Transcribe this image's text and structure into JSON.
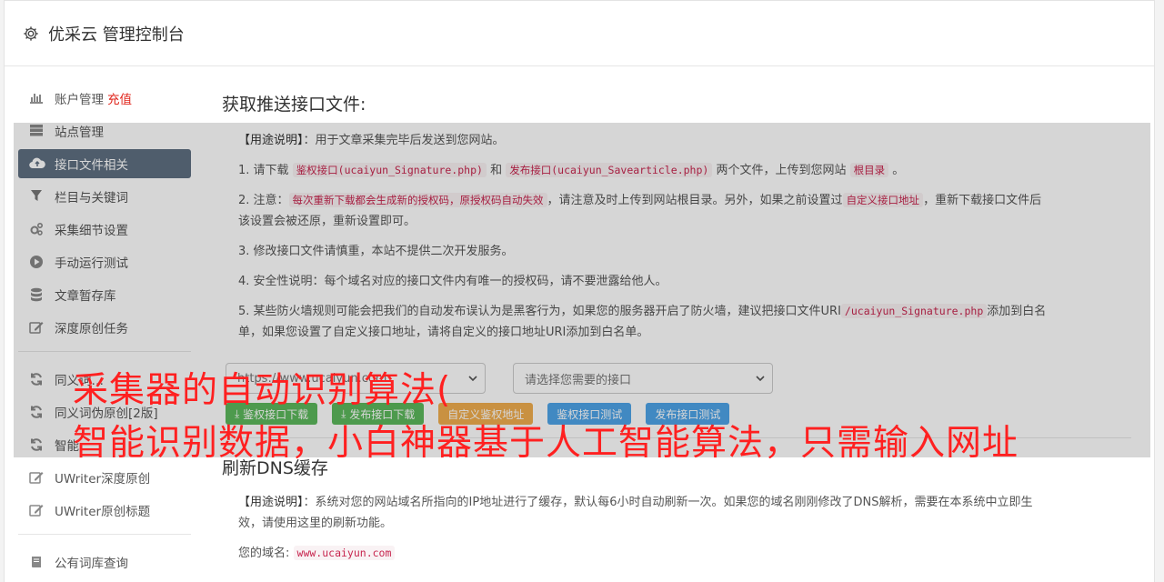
{
  "header": {
    "title": "优采云 管理控制台",
    "logo_icon": "gear-icon"
  },
  "sidebar": {
    "items": [
      {
        "label": "账户管理",
        "badge": "充值",
        "icon": "bar-chart-icon"
      },
      {
        "label": "站点管理",
        "icon": "server-icon"
      },
      {
        "label": "接口文件相关",
        "icon": "cloud-upload-icon",
        "active": true
      },
      {
        "label": "栏目与关键词",
        "icon": "filter-icon"
      },
      {
        "label": "采集细节设置",
        "icon": "gears-icon"
      },
      {
        "label": "手动运行测试",
        "icon": "play-circle-icon"
      },
      {
        "label": "文章暂存库",
        "icon": "database-icon"
      },
      {
        "label": "深度原创任务",
        "icon": "edit-icon"
      }
    ],
    "items2": [
      {
        "label": "同义词…",
        "icon": "refresh-icon"
      },
      {
        "label": "同义词伪原创[2版]",
        "icon": "refresh-icon"
      },
      {
        "label": "智能…",
        "icon": "refresh-icon"
      },
      {
        "label": "UWriter深度原创",
        "icon": "edit-icon"
      },
      {
        "label": "UWriter原创标题",
        "icon": "edit-icon"
      }
    ],
    "items3": [
      {
        "label": "公有词库查询",
        "icon": "book-icon"
      }
    ]
  },
  "main": {
    "section1": {
      "title": "获取推送接口文件:",
      "usage_prefix": "【用途说明】",
      "usage_text": "：用于文章采集完毕后发送到您网站。",
      "p1_a": "1. 请下载",
      "p1_code1": "鉴权接口(ucaiyun_Signature.php)",
      "p1_b": "和",
      "p1_code2": "发布接口(ucaiyun_Savearticle.php)",
      "p1_c": "两个文件，上传到您网站",
      "p1_code3": "根目录",
      "p1_d": "。",
      "p2_a": "2. 注意：",
      "p2_code1": "每次重新下载都会生成新的授权码，原授权码自动失效",
      "p2_b": "，请注意及时上传到网站根目录。另外，如果之前设置过",
      "p2_code2": "自定义接口地址",
      "p2_c": "，重新下载接口文件后该设置会被还原，重新设置即可。",
      "p3": "3. 修改接口文件请慎重，本站不提供二次开发服务。",
      "p4": "4. 安全性说明：每个域名对应的接口文件内有唯一的授权码，请不要泄露给他人。",
      "p5_a": "5. 某些防火墙规则可能会把我们的自动发布误认为是黑客行为，如果您的服务器开启了防火墙，建议把接口文件URI",
      "p5_code": "/ucaiyun_Signature.php",
      "p5_b": "添加到白名单，如果您设置了自定义接口地址，请将自定义的接口地址URI添加到白名单。",
      "site_select": "https://www.ucaiyun.com",
      "api_select": "请选择您需要的接口",
      "btn_download_auth": "鉴权接口下载",
      "btn_download_publish": "发布接口下载",
      "btn_custom_auth": "自定义鉴权地址",
      "btn_test_auth": "鉴权接口测试",
      "btn_test_publish": "发布接口测试"
    },
    "section2": {
      "title": "刷新DNS缓存",
      "usage_prefix": "【用途说明】",
      "usage_text": "：系统对您的网站域名所指向的IP地址进行了缓存，默认每6小时自动刷新一次。如果您的域名刚刚修改了DNS解析，需要在本系统中立即生效，请使用这里的刷新功能。",
      "domain_label": "您的域名:",
      "domain_value": "www.ucaiyun.com"
    }
  },
  "caption": {
    "line1": "采集器的自动识别算法(",
    "line2": "智能识别数据，小白神器基于人工智能算法，只需输入网址"
  },
  "colors": {
    "active_bg": "#5f6f81",
    "caption": "#ff2020",
    "charge": "#e0241b"
  }
}
